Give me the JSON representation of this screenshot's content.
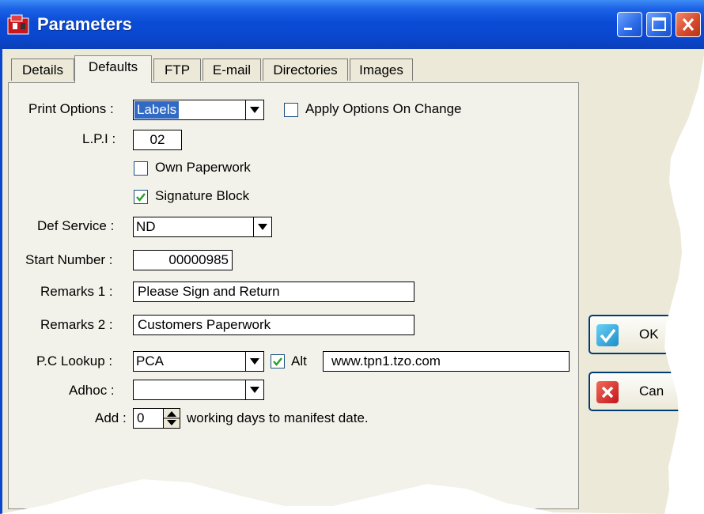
{
  "window": {
    "title": "Parameters"
  },
  "tabs": [
    {
      "label": "Details",
      "active": false
    },
    {
      "label": "Defaults",
      "active": true
    },
    {
      "label": "FTP",
      "active": false
    },
    {
      "label": "E-mail",
      "active": false
    },
    {
      "label": "Directories",
      "active": false
    },
    {
      "label": "Images",
      "active": false
    }
  ],
  "form": {
    "print_options_label": "Print Options :",
    "print_options_value": "Labels",
    "apply_options_label": "Apply Options On Change",
    "apply_options_checked": false,
    "lpi_label": "L.P.I :",
    "lpi_value": "02",
    "own_paperwork_label": "Own Paperwork",
    "own_paperwork_checked": false,
    "signature_block_label": "Signature Block",
    "signature_block_checked": true,
    "def_service_label": "Def Service :",
    "def_service_value": "ND",
    "start_number_label": "Start Number :",
    "start_number_value": "00000985",
    "remarks1_label": "Remarks 1 :",
    "remarks1_value": "Please Sign and Return",
    "remarks2_label": "Remarks 2 :",
    "remarks2_value": "Customers Paperwork",
    "pc_lookup_label": "P.C Lookup :",
    "pc_lookup_value": "PCA",
    "alt_label": "Alt",
    "alt_checked": true,
    "alt_url_value": "www.tpn1.tzo.com",
    "adhoc_label": "Adhoc :",
    "adhoc_value": "",
    "add_label": "Add :",
    "add_value": "0",
    "add_suffix": "working days to manifest date."
  },
  "buttons": {
    "ok_label": "OK",
    "cancel_label": "Can"
  },
  "colors": {
    "titlebar": "#0a47cf",
    "selection": "#316ac5",
    "check": "#21a121",
    "ok_icon": "#2aa3d8",
    "cancel_icon": "#d32020"
  }
}
